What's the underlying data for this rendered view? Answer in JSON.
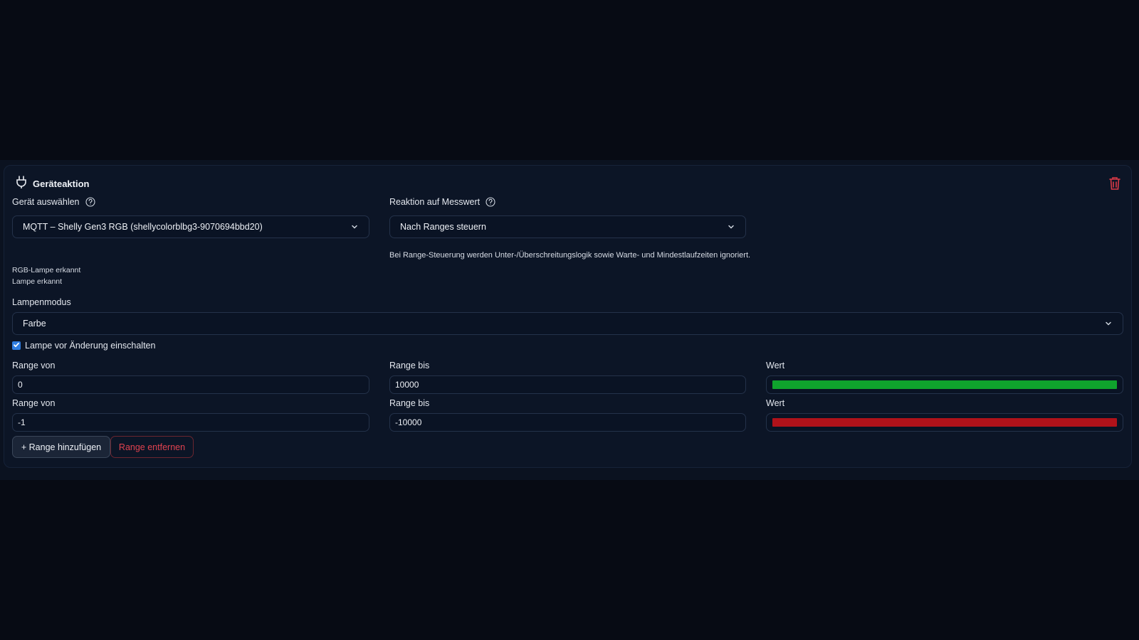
{
  "card": {
    "title": "Geräteaktion",
    "icons": {
      "header": "plug-icon",
      "delete": "trash-icon"
    }
  },
  "device": {
    "label": "Gerät auswählen",
    "value": "MQTT – Shelly Gen3 RGB (shellycolorblbg3-9070694bbd20)"
  },
  "reaction": {
    "label": "Reaktion auf Messwert",
    "value": "Nach Ranges steuern",
    "note": "Bei Range-Steuerung werden Unter-/Überschreitungslogik sowie Warte- und Mindestlaufzeiten ignoriert."
  },
  "detection": {
    "rgb": "RGB-Lampe erkannt",
    "lamp": "Lampe erkannt"
  },
  "lamp_mode": {
    "label": "Lampenmodus",
    "value": "Farbe"
  },
  "turn_on": {
    "label": "Lampe vor Änderung einschalten",
    "checked": true
  },
  "ranges": [
    {
      "from_label": "Range von",
      "from": "0",
      "to_label": "Range bis",
      "to": "10000",
      "value_label": "Wert",
      "color": "#0fa32d"
    },
    {
      "from_label": "Range von",
      "from": "-1",
      "to_label": "Range bis",
      "to": "-10000",
      "value_label": "Wert",
      "color": "#b0121a"
    }
  ],
  "buttons": {
    "add": "+ Range hinzufügen",
    "remove": "Range entfernen"
  },
  "colors": {
    "background": "#070b14",
    "card": "#0c1526",
    "accent": "#2f7de1",
    "danger": "#e0424f"
  }
}
